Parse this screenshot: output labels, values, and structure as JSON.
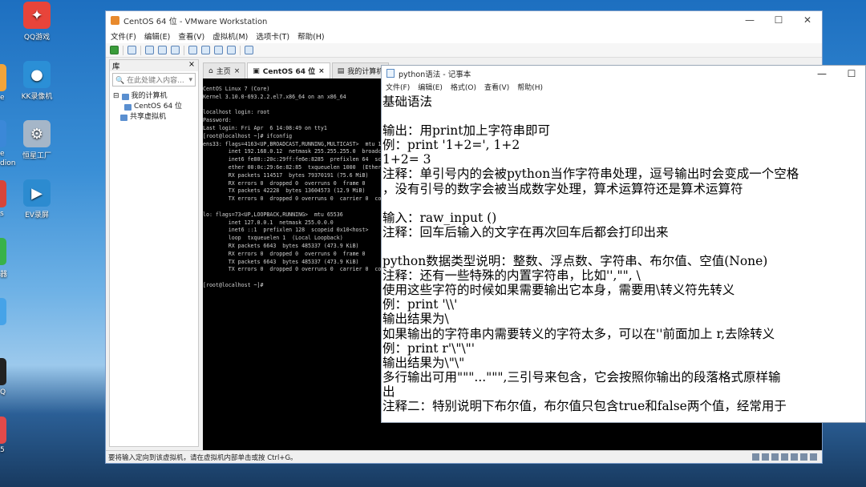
{
  "desktop": {
    "icons": [
      {
        "label": "QQ游戏",
        "icon": "qq-game-icon",
        "color": "#e8443a"
      },
      {
        "label": "KK录像机",
        "icon": "kk-recorder-icon",
        "color": "#2b8fd6"
      },
      {
        "label": "恒星工厂",
        "icon": "factory-icon",
        "color": "#a5b6c8"
      },
      {
        "label": "EV录屏",
        "icon": "ev-recorder-icon",
        "color": "#2c8bd0"
      }
    ],
    "edge_labels": [
      "e",
      "e",
      "dion",
      "s",
      "器",
      "Q",
      "5"
    ]
  },
  "vmware": {
    "title": "CentOS 64 位 - VMware Workstation",
    "menu": [
      "文件(F)",
      "编辑(E)",
      "查看(V)",
      "虚拟机(M)",
      "选项卡(T)",
      "帮助(H)"
    ],
    "library": {
      "header": "库",
      "search_placeholder": "在此处键入内容...",
      "tree": {
        "root": "我的计算机",
        "child": "CentOS 64 位",
        "shared": "共享虚拟机"
      }
    },
    "tabs": [
      "主页",
      "CentOS 64 位",
      "我的计算机"
    ],
    "console_lines": [
      "CentOS Linux 7 (Core)",
      "Kernel 3.10.0-693.2.2.el7.x86_64 on an x86_64",
      "",
      "localhost login: root",
      "Password:",
      "Last login: Fri Apr  6 14:08:49 on tty1",
      "[root@localhost ~]# ifconfig",
      "ens33: flags=4163<UP,BROADCAST,RUNNING,MULTICAST>  mtu 1500",
      "        inet 192.168.0.12  netmask 255.255.255.0  broadcast 192.168.0.255",
      "        inet6 fe80::20c:29ff:fe6e:8285  prefixlen 64  scopeid 0x20<link>",
      "        ether 00:0c:29:6e:82:85  txqueuelen 1000  (Ethernet)",
      "        RX packets 114517  bytes 79370191 (75.6 MiB)",
      "        RX errors 0  dropped 0  overruns 0  frame 0",
      "        TX packets 42228  bytes 13604573 (12.9 MiB)",
      "        TX errors 0  dropped 0 overruns 0  carrier 0  collisions 0",
      "",
      "lo: flags=73<UP,LOOPBACK,RUNNING>  mtu 65536",
      "        inet 127.0.0.1  netmask 255.0.0.0",
      "        inet6 ::1  prefixlen 128  scopeid 0x10<host>",
      "        loop  txqueuelen 1  (Local Loopback)",
      "        RX packets 6643  bytes 485337 (473.9 KiB)",
      "        RX errors 0  dropped 0  overruns 0  frame 0",
      "        TX packets 6643  bytes 485337 (473.9 KiB)",
      "        TX errors 0  dropped 0 overruns 0  carrier 0  collisions 0",
      "",
      "[root@localhost ~]#"
    ],
    "status": "要将输入定向到该虚拟机，请在虚拟机内部单击或按 Ctrl+G。"
  },
  "notepad": {
    "title": "python语法 - 记事本",
    "menu": [
      "文件(F)",
      "编辑(E)",
      "格式(O)",
      "查看(V)",
      "帮助(H)"
    ],
    "lines": [
      "基础语法",
      "",
      "输出：用print加上字符串即可",
      "例：print '1+2=', 1+2",
      "1+2= 3",
      "注释：单引号内的会被python当作字符串处理，逗号输出时会变成一个空格",
      "，没有引号的数字会被当成数字处理，算术运算符还是算术运算符",
      "",
      "输入：raw_input ()",
      "注释：回车后输入的文字在再次回车后都会打印出来",
      "",
      "python数据类型说明：整数、浮点数、字符串、布尔值、空值(None)",
      "注释：还有一些特殊的内置字符串，比如'',\"\", \\",
      "使用这些字符的时候如果需要输出它本身，需要用\\转义符先转义",
      "例：print '\\\\'",
      "输出结果为\\",
      "如果输出的字符串内需要转义的字符太多，可以在''前面加上 r,去除转义",
      "例：print r'\\\"\\\"'",
      "输出结果为\\\"\\\"",
      "多行输出可用\"\"\"...\"\"\",三引号来包含，它会按照你输出的段落格式原样输",
      "出",
      "注释二：特别说明下布尔值，布尔值只包含true和false两个值，经常用于"
    ]
  }
}
